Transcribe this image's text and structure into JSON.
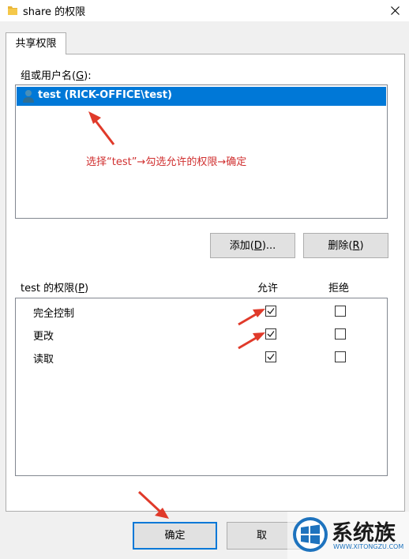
{
  "window": {
    "title": "share 的权限",
    "title_icon": "folder-icon",
    "close_icon": "close-icon"
  },
  "tab": {
    "label": "共享权限"
  },
  "group_section": {
    "label_text": "组或用户名(",
    "label_key": "G",
    "label_end": "):",
    "users": [
      {
        "name": "test (RICK-OFFICE\\test)",
        "selected": true,
        "icon": "user-icon"
      }
    ]
  },
  "annotation": {
    "text": "选择“test”→勾选允许的权限→确定",
    "color": "#d03030"
  },
  "buttons": {
    "add": {
      "text": "添加(",
      "key": "D",
      "end": ")..."
    },
    "remove": {
      "text": "删除(",
      "key": "R",
      "end": ")"
    }
  },
  "permissions": {
    "label_text": "test 的权限(",
    "label_key": "P",
    "label_end": ")",
    "col_allow": "允许",
    "col_deny": "拒绝",
    "rows": [
      {
        "name": "完全控制",
        "allow": true,
        "deny": false
      },
      {
        "name": "更改",
        "allow": true,
        "deny": false
      },
      {
        "name": "读取",
        "allow": true,
        "deny": false
      }
    ]
  },
  "footer": {
    "ok_label": "确定",
    "cancel_label": "取"
  },
  "watermark": {
    "title": "系统族",
    "url": "WWW.XITONGZU.COM"
  },
  "colors": {
    "selection": "#0078d7",
    "arrow": "#e03a2a"
  }
}
